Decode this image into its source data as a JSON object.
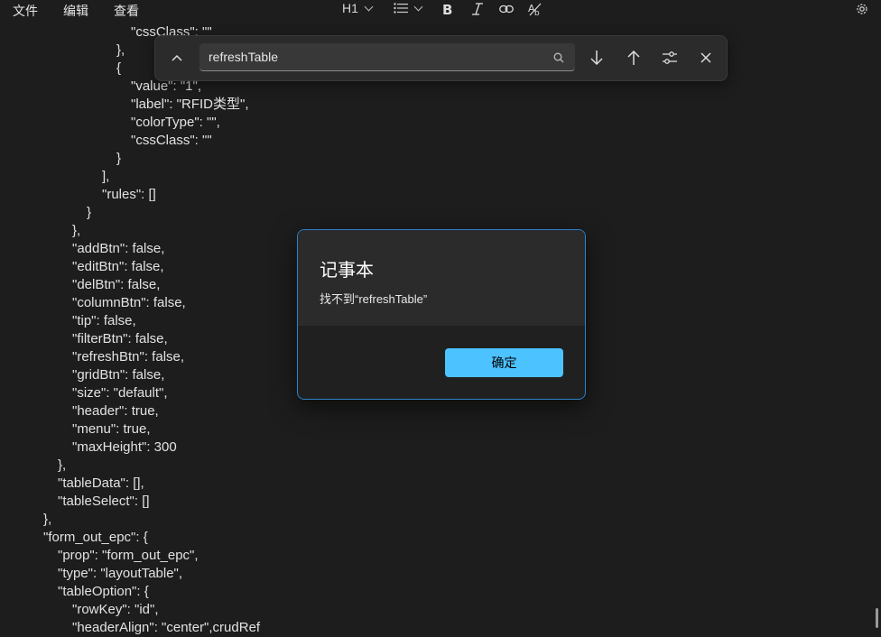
{
  "menubar": {
    "file": "文件",
    "edit": "编辑",
    "view": "查看",
    "heading": "H1"
  },
  "code_lines": [
    "\"cssClass\": \"\"",
    "},",
    "{",
    "\"value\": \"1\",",
    "\"label\": \"RFID类型\",",
    "\"colorType\": \"\",",
    "\"cssClass\": \"\"",
    "}",
    "],",
    "\"rules\": []",
    "}",
    "},",
    "\"addBtn\": false,",
    "\"editBtn\": false,",
    "\"delBtn\": false,",
    "\"columnBtn\": false,",
    "\"tip\": false,",
    "\"filterBtn\": false,",
    "\"refreshBtn\": false,",
    "\"gridBtn\": false,",
    "\"size\": \"default\",",
    "\"header\": true,",
    "\"menu\": true,",
    "\"maxHeight\": 300",
    "},",
    "\"tableData\": [],",
    "\"tableSelect\": []",
    "},",
    "\"form_out_epc\": {",
    "\"prop\": \"form_out_epc\",",
    "\"type\": \"layoutTable\",",
    "\"tableOption\": {",
    "\"rowKey\": \"id\",",
    "\"headerAlign\": \"center\",crudRef"
  ],
  "find": {
    "query": "refreshTable"
  },
  "dialog": {
    "title": "记事本",
    "message": "找不到“refreshTable”",
    "ok_label": "确定"
  },
  "colors": {
    "accent": "#4cc2ff",
    "dialog_border": "#2f7fc9"
  }
}
